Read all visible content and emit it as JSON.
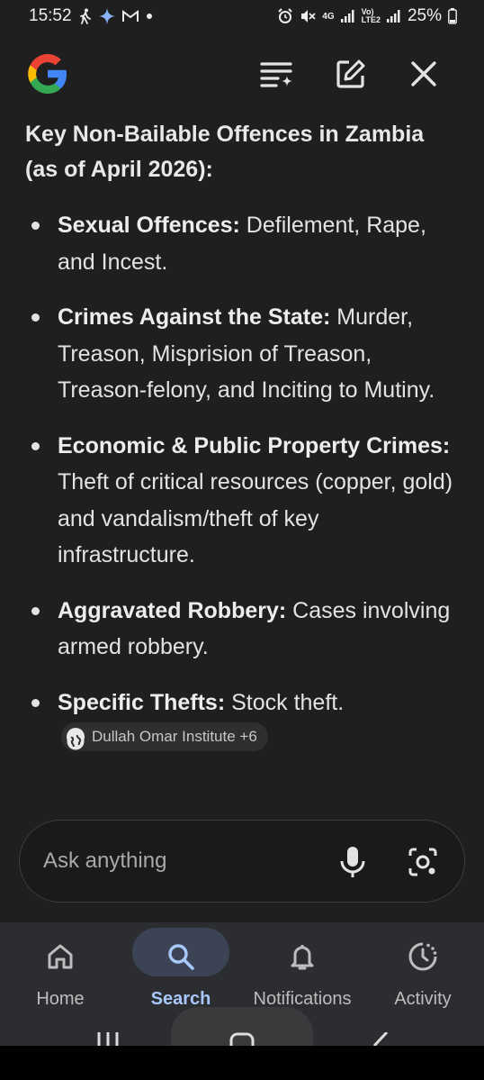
{
  "status_bar": {
    "time": "15:52",
    "network_4g": "4G",
    "volte": "Vo)\nLTE2",
    "battery": "25%"
  },
  "top_bar": {
    "logo": "google-g-logo",
    "icons": [
      "list-sparkle-icon",
      "edit-icon",
      "close-icon"
    ]
  },
  "content": {
    "heading": "Key Non-Bailable Offences in Zambia (as of April 2026):",
    "items": [
      {
        "term": "Sexual Offences:",
        "text": " Defilement, Rape, and Incest."
      },
      {
        "term": "Crimes Against the State:",
        "text": " Murder, Treason, Misprision of Treason, Treason-felony, and Inciting to Mutiny."
      },
      {
        "term": "Economic & Public Property Crimes:",
        "text": " Theft of critical resources (copper, gold) and vandalism/theft of key infrastructure."
      },
      {
        "term": "Aggravated Robbery:",
        "text": " Cases involving armed robbery."
      },
      {
        "term": "Specific Thefts:",
        "text": " Stock theft."
      }
    ],
    "source_chip": "Dullah Omar Institute +6"
  },
  "ask_bar": {
    "placeholder": "Ask anything",
    "icons": [
      "microphone-icon",
      "lens-camera-icon"
    ]
  },
  "bottom_nav": {
    "items": [
      {
        "label": "Home",
        "icon": "home-icon",
        "active": false
      },
      {
        "label": "Search",
        "icon": "search-icon",
        "active": true
      },
      {
        "label": "Notifications",
        "icon": "bell-icon",
        "active": false
      },
      {
        "label": "Activity",
        "icon": "activity-clock-icon",
        "active": false
      }
    ]
  },
  "colors": {
    "background": "#1f1f1f",
    "text": "#e3e3e3",
    "accent": "#a8c7fa",
    "nav_background": "#2c2d30"
  }
}
